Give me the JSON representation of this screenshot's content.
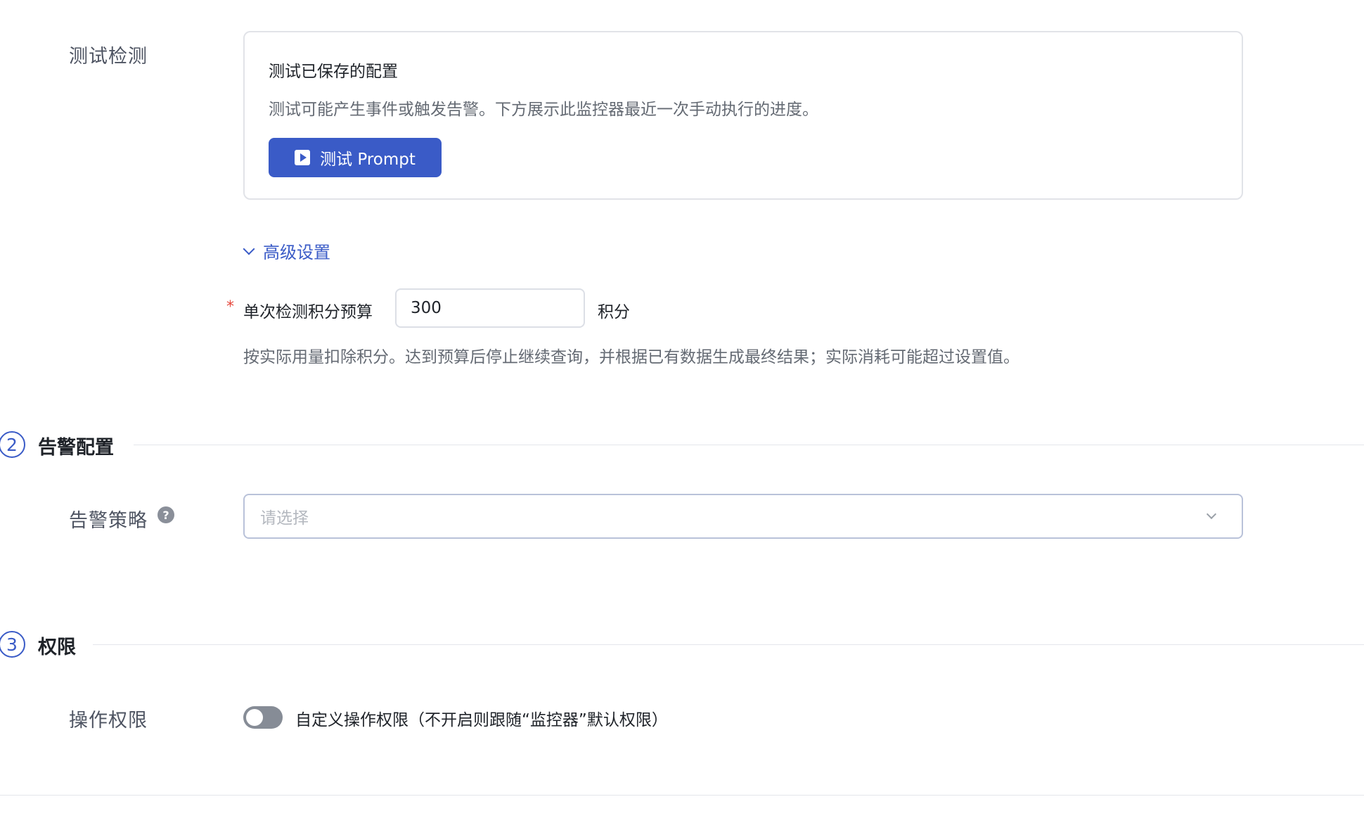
{
  "test_section": {
    "label": "测试检测",
    "card_title": "测试已保存的配置",
    "card_desc": "测试可能产生事件或触发告警。下方展示此监控器最近一次手动执行的进度。",
    "test_button_label": "测试 Prompt"
  },
  "advanced": {
    "toggle_label": "高级设置",
    "budget_label": "单次检测积分预算",
    "required_mark": "*",
    "budget_value": "300",
    "budget_unit": "积分",
    "budget_hint": "按实际用量扣除积分。达到预算后停止继续查询，并根据已有数据生成最终结果；实际消耗可能超过设置值。"
  },
  "alert_section": {
    "index": "2",
    "title": "告警配置",
    "policy_label": "告警策略",
    "help_icon": "?",
    "policy_placeholder": "请选择"
  },
  "permission_section": {
    "index": "3",
    "title": "权限",
    "row_label": "操作权限",
    "toggle_text": "自定义操作权限（不开启则跟随“监控器”默认权限）",
    "toggle_on": false
  },
  "colors": {
    "accent": "#3a5bc7",
    "required": "#e5483d",
    "toggle_off": "#868c96"
  }
}
